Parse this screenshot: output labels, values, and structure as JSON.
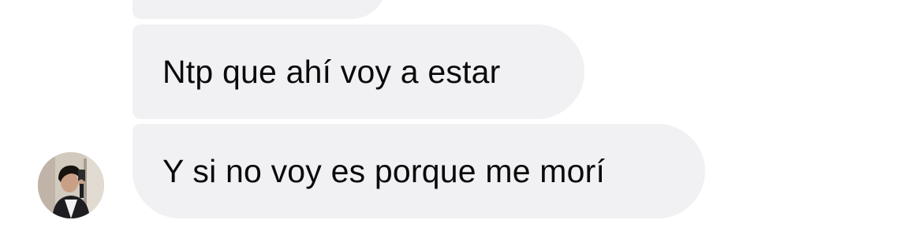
{
  "conversation": {
    "messages": [
      {
        "text": ""
      },
      {
        "text": "Ntp que ahí voy a estar"
      },
      {
        "text": "Y si no voy es porque me morí"
      }
    ],
    "contact": {
      "avatar_icon": "user-photo-avatar"
    }
  },
  "colors": {
    "bubble_bg": "#f1f1f4",
    "text": "#0a0a0a",
    "background": "#ffffff"
  }
}
